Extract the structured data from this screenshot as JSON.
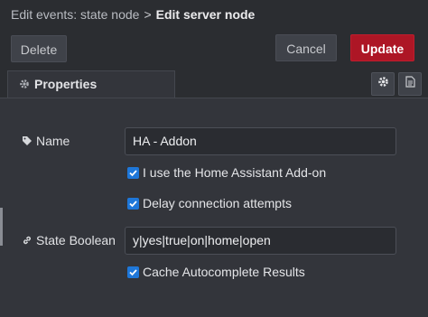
{
  "breadcrumb": {
    "parent": "Edit events: state node",
    "separator": ">",
    "current": "Edit server node"
  },
  "toolbar": {
    "delete_label": "Delete",
    "cancel_label": "Cancel",
    "update_label": "Update"
  },
  "tabs": [
    {
      "label": "Properties",
      "icon": "gear-icon",
      "active": true
    }
  ],
  "tab_icons": [
    "gear-icon",
    "description-icon"
  ],
  "form": {
    "name": {
      "label": "Name",
      "icon": "tag-icon",
      "value": "HA - Addon"
    },
    "addon_checkbox": {
      "label": "I use the Home Assistant Add-on",
      "checked": true
    },
    "delay_checkbox": {
      "label": "Delay connection attempts",
      "checked": true
    },
    "state_boolean": {
      "label": "State Boolean",
      "icon": "link-icon",
      "value": "y|yes|true|on|home|open"
    },
    "cache_checkbox": {
      "label": "Cache Autocomplete Results",
      "checked": true
    }
  },
  "colors": {
    "accent_update": "#ad1625",
    "checkbox": "#1e77d9",
    "background": "#33353b"
  }
}
